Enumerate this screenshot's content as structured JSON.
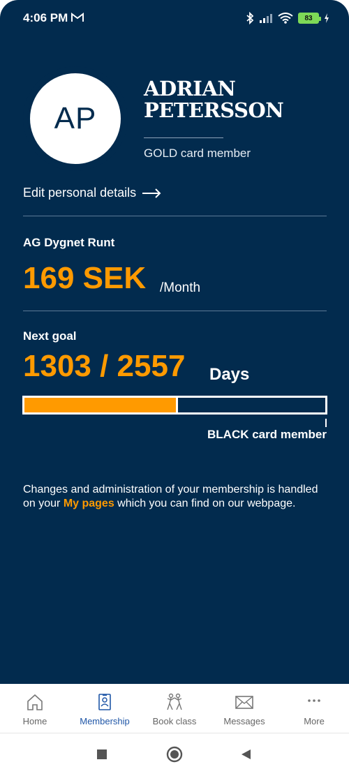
{
  "status_bar": {
    "time": "4:06 PM",
    "battery": "83"
  },
  "profile": {
    "initials": "AP",
    "name_line1": "ADRIAN",
    "name_line2": "PETERSSON",
    "card_level": "GOLD card member",
    "edit_link": "Edit personal details"
  },
  "membership": {
    "plan_name": "AG Dygnet Runt",
    "price": "169 SEK",
    "price_unit": "/Month"
  },
  "goal": {
    "label": "Next goal",
    "value": "1303 / 2557",
    "unit": "Days",
    "progress_fraction": 0.51,
    "target_label": "BLACK card member"
  },
  "info": {
    "text_before": "Changes and administration of your membership is handled on your ",
    "link_text": "My pages",
    "text_after": " which you can find on our webpage."
  },
  "nav": {
    "home": "Home",
    "membership": "Membership",
    "book_class": "Book class",
    "messages": "Messages",
    "more": "More",
    "active": "membership"
  },
  "colors": {
    "background": "#022b4e",
    "accent": "#ff9a00",
    "active_nav": "#1f56a7"
  }
}
